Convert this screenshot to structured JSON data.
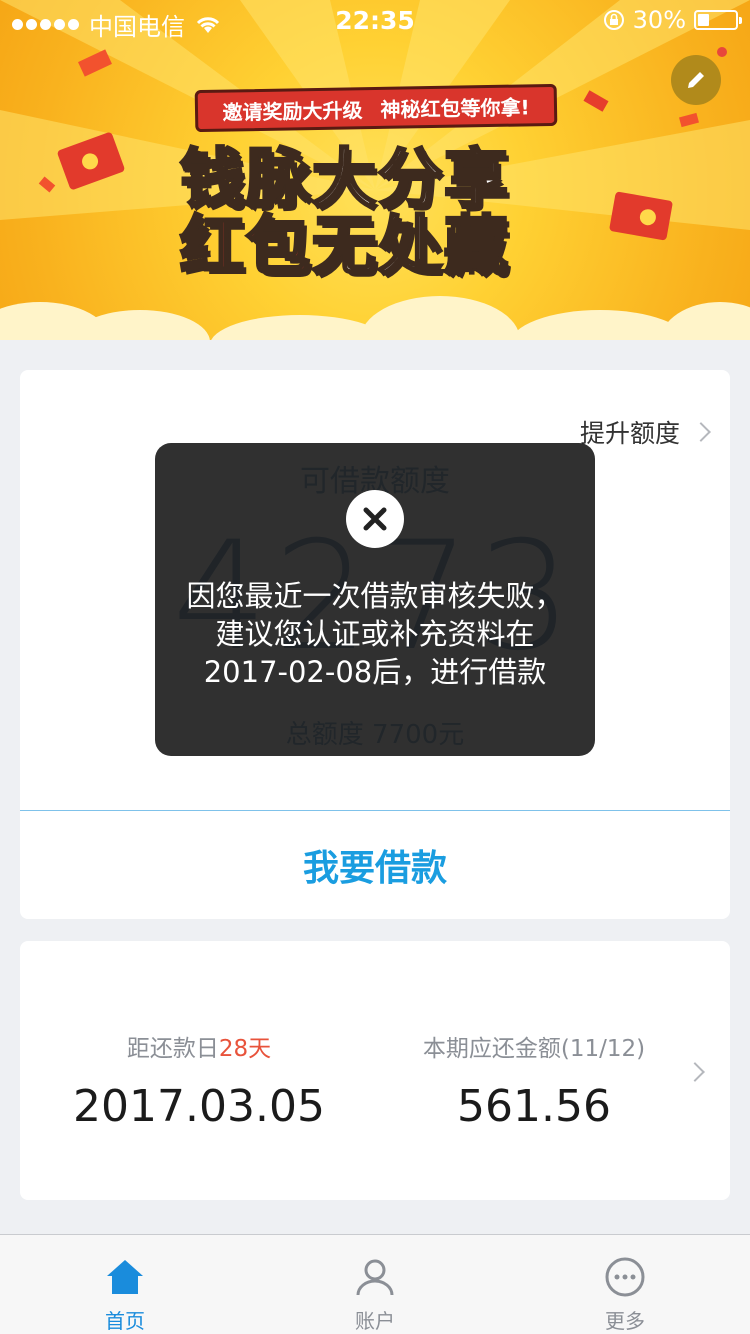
{
  "status_bar": {
    "carrier": "中国电信",
    "time": "22:35",
    "battery_percent": "30%",
    "battery_level": 0.3
  },
  "banner": {
    "ribbon_left": "邀请奖励大升级",
    "ribbon_right": "神秘红包等你拿!",
    "headline_1a": "钱脉",
    "headline_1b": "大分享",
    "headline_2a": "红包",
    "headline_2b": "无处藏",
    "edit_icon": "pencil-icon"
  },
  "credit_card": {
    "raise_limit_label": "提升额度",
    "available_label": "可借款额度",
    "available_amount": "4273",
    "total_line": "总额度 7700元",
    "borrow_button": "我要借款"
  },
  "repayment_card": {
    "due_label_prefix": "距还款日",
    "due_days": "28天",
    "due_date": "2017.03.05",
    "amount_label": "本期应还金额(11/12)",
    "amount_value": "561.56"
  },
  "tabbar": {
    "tabs": [
      {
        "label": "首页",
        "icon": "home-icon",
        "active": true
      },
      {
        "label": "账户",
        "icon": "person-icon",
        "active": false
      },
      {
        "label": "更多",
        "icon": "more-icon",
        "active": false
      }
    ]
  },
  "toast": {
    "message": "因您最近一次借款审核失败，建议您认证或补充资料在2017-02-08后，进行借款"
  },
  "colors": {
    "accent": "#1a9de0",
    "banner_yellow": "#ffd133",
    "warning_red": "#e8533b"
  }
}
